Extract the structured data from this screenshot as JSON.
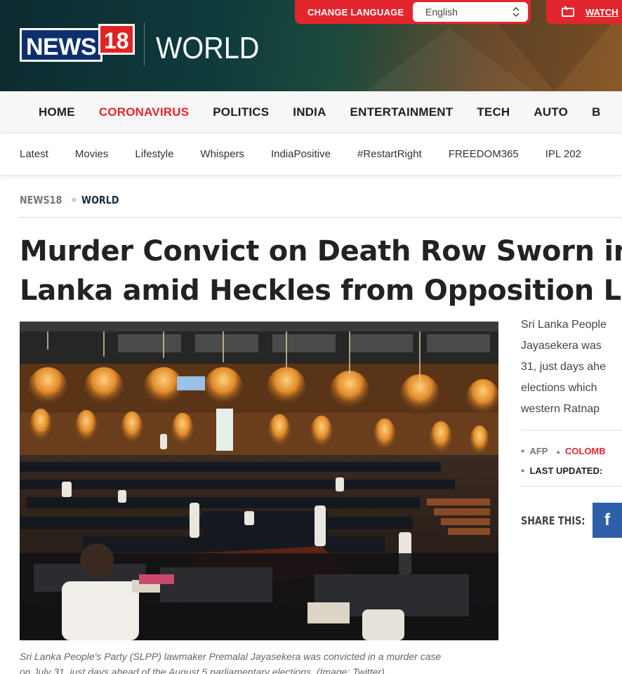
{
  "header": {
    "logo_news": "NEWS",
    "logo_18": "18",
    "section_title": "WORLD",
    "change_language_label": "CHANGE LANGUAGE",
    "language_selected": "English",
    "watch_label": "WATCH"
  },
  "main_nav": {
    "items": [
      "HOME",
      "CORONAVIRUS",
      "POLITICS",
      "INDIA",
      "ENTERTAINMENT",
      "TECH",
      "AUTO",
      "B"
    ],
    "active": "CORONAVIRUS"
  },
  "sub_nav": {
    "items": [
      "Latest",
      "Movies",
      "Lifestyle",
      "Whispers",
      "IndiaPositive",
      "#RestartRight",
      "FREEDOM365",
      "IPL 202"
    ]
  },
  "breadcrumb": {
    "home": "NEWS18",
    "separator": "»",
    "current": "WORLD"
  },
  "article": {
    "headline_line1": "Murder Convict on Death Row Sworn in a",
    "headline_line2": "Lanka amid Heckles from Opposition Lea",
    "intro_lines": [
      "Sri Lanka People",
      "Jayasekera was",
      "31, just days ahe",
      "elections which",
      "western Ratnap"
    ],
    "caption_line1": "Sri Lanka People's Party (SLPP) lawmaker Premalal Jayasekera was convicted in a murder case",
    "caption_line2": "on July 31, just days ahead of the August 5 parliamentary elections. (Image: Twitter)",
    "source": "AFP",
    "location": "COLOMB",
    "last_updated_label": "LAST UPDATED:",
    "share_label": "SHARE THIS:",
    "facebook_glyph": "f"
  },
  "colors": {
    "accent_red": "#e3262d",
    "brand_navy": "#0d2f6d",
    "facebook_blue": "#2d5fa8"
  }
}
